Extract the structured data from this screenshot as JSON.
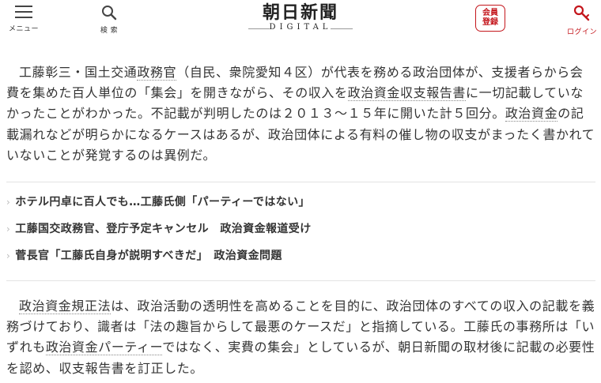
{
  "header": {
    "menu_label": "メニュー",
    "search_label": "検 索",
    "logo_main": "朝日新聞",
    "logo_sub": "DIGITAL",
    "member_line1": "会員",
    "member_line2": "登録",
    "login_label": "ログイン",
    "login_color": "#c4161c"
  },
  "article": {
    "p1": [
      {
        "t": "工藤彰三・国土交通"
      },
      {
        "t": "政務官",
        "k": true
      },
      {
        "t": "（自民、衆院愛知４区）が代表を務める政治団体が、支援者らから会費を集めた百人単位の「集会」を開きながら、その収入を"
      },
      {
        "t": "政治資金収支報告書",
        "k": true
      },
      {
        "t": "に一切記載していなかったことがわかった。不記載が判明したのは２０１３〜１５年に開いた計５回分。"
      },
      {
        "t": "政治資金",
        "k": true
      },
      {
        "t": "の記載漏れなどが明らかになるケースはあるが、政治団体による有料の催し物の収支がまったく書かれていないことが発覚するのは異例だ。"
      }
    ],
    "related_links": [
      "ホテル円卓に百人でも…工藤氏側「パーティーではない」",
      "工藤国交政務官、登庁予定キャンセル　政治資金報道受け",
      "菅長官「工藤氏自身が説明すべきだ」　政治資金問題"
    ],
    "p2": [
      {
        "t": "政治資金規正法",
        "k": true
      },
      {
        "t": "は、政治活動の透明性を高めることを目的に、政治団体のすべての収入の記載を義務づけており、識者は「法の趣旨からして最悪のケースだ」と指摘している。工藤氏の事務所は「いずれも"
      },
      {
        "t": "政治資金パーティー",
        "k": true
      },
      {
        "t": "ではなく、実費の集会」としているが、朝日新聞の取材後に記載の必要性を認め、収支報告書を訂正した。"
      }
    ]
  }
}
